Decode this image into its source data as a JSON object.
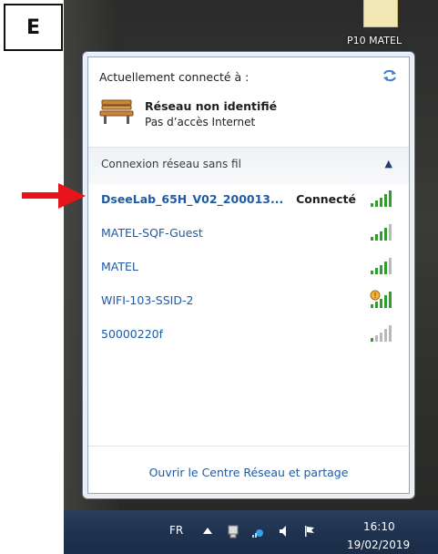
{
  "label": "E",
  "desktop": {
    "item_label": "P10 MATEL"
  },
  "flyout": {
    "header": "Actuellement connecté à :",
    "current_network": {
      "name": "Réseau non identifié",
      "status": "Pas d’accès Internet"
    },
    "section_title": "Connexion réseau sans fil",
    "networks": [
      {
        "name": "DseeLab_65H_V02_200013...",
        "status": "Connecté",
        "icon": "wifi-signal-icon"
      },
      {
        "name": "MATEL-SQF-Guest",
        "status": "",
        "icon": "wifi-signal-icon"
      },
      {
        "name": "MATEL",
        "status": "",
        "icon": "wifi-signal-icon"
      },
      {
        "name": "WIFI-103-SSID-2",
        "status": "",
        "icon": "wifi-signal-secured-icon"
      },
      {
        "name": "50000220f",
        "status": "",
        "icon": "wifi-signal-weak-icon"
      }
    ],
    "footer_link": "Ouvrir le Centre Réseau et partage"
  },
  "taskbar": {
    "language": "FR",
    "time": "16:10",
    "date": "19/02/2019"
  },
  "colors": {
    "link": "#1e5aa6",
    "arrow": "#e8141b",
    "taskbar": "#1f3350"
  }
}
